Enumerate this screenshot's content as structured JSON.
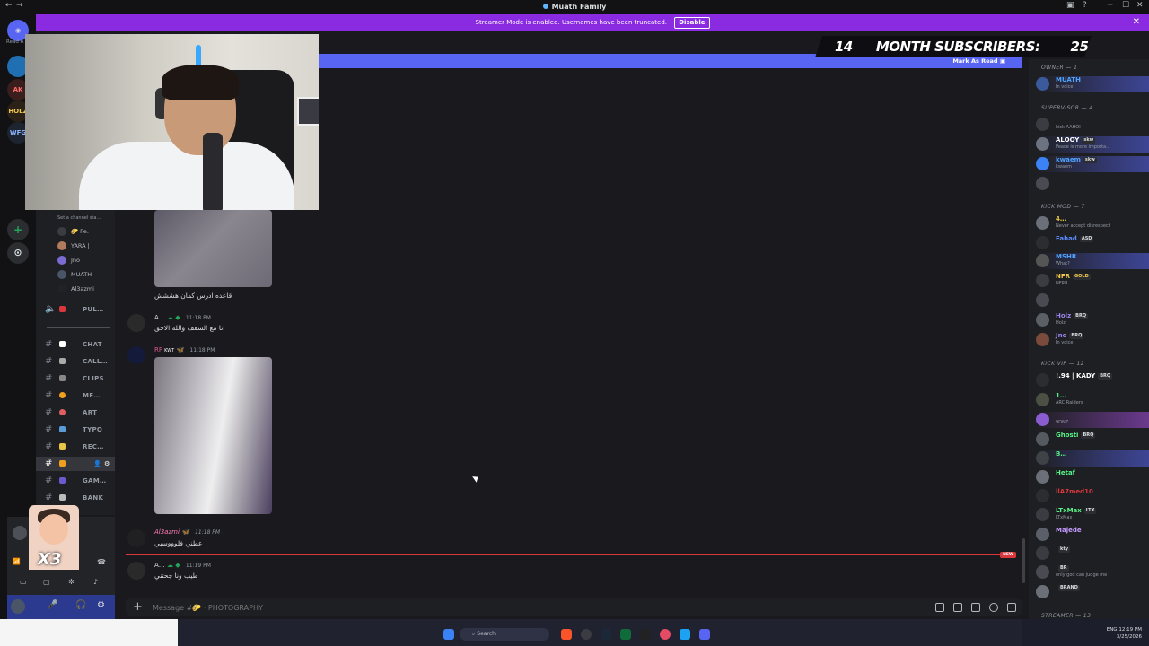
{
  "window": {
    "title": "Muath Family"
  },
  "streamer_bar": {
    "text": "Streamer Mode is enabled. Usernames have been truncated.",
    "disable_label": "Disable"
  },
  "overlay": {
    "count_left": "14",
    "label": "MONTH SUBSCRIBERS:",
    "count_right": "25"
  },
  "mark_read": {
    "label": "Mark As Read"
  },
  "rail": {
    "top_label": "Read A",
    "servers": [
      "AK",
      "HOLZ",
      "WFG",
      "+",
      "⊙"
    ]
  },
  "channels": {
    "status_hint": "Set a channel sta…",
    "voice_users": [
      "YARA |",
      "Jno",
      "MUATH",
      "Al3azmi"
    ],
    "list": [
      {
        "label": "PUL…",
        "voice": true
      },
      {
        "label": "CHAT"
      },
      {
        "label": "CALL…"
      },
      {
        "label": "CLIPS"
      },
      {
        "label": "ME…"
      },
      {
        "label": "ART"
      },
      {
        "label": "TYPO"
      },
      {
        "label": "REC…"
      },
      {
        "label": "",
        "active": true
      },
      {
        "label": "GAM…"
      },
      {
        "label": "BANK"
      }
    ],
    "baby_overlay_text": "X3"
  },
  "messages": [
    {
      "text": "قاعده ادرس كمان هششش"
    },
    {
      "name": "A…",
      "time": "11:18 PM",
      "text": "انا مع السقف والله الاحق"
    },
    {
      "name": "RF",
      "badge": "KWT",
      "time": "11:18 PM"
    },
    {
      "name": "Al3azmi",
      "time": "11:18 PM",
      "text": "عطني فلوووسيي"
    },
    {
      "name": "A…",
      "time": "11:19 PM",
      "text": "طيب ونا جحتني"
    }
  ],
  "new_badge": "NEW",
  "composer": {
    "placeholder": "Message #🌮 · PHOTOGRAPHY"
  },
  "members": {
    "groups": [
      {
        "label": "OWNER — 1"
      },
      {
        "label": "SUPERVISOR — 4"
      },
      {
        "label": "KICK MOD — 7"
      },
      {
        "label": "KICK VIP — 12"
      },
      {
        "label": "STREAMER — 13"
      }
    ],
    "owner": [
      {
        "name": "MUATH",
        "status": "In voice",
        "color": "#4fa3ff"
      }
    ],
    "supervisor": [
      {
        "name": "",
        "status": "kick AAHOI",
        "color": "#da373c"
      },
      {
        "name": "ALOOY",
        "tag": "skw",
        "status": "Peace is more importa…",
        "color": "#ffffff"
      },
      {
        "name": "kwaem",
        "tag": "skw",
        "status": "kwaem",
        "color": "#4fa3ff"
      },
      {
        "name": "",
        "status": "",
        "color": "#da373c"
      }
    ],
    "kick_mod": [
      {
        "name": "4…",
        "status": "Never accept disrespect",
        "color": "#e8c547"
      },
      {
        "name": "Fahad",
        "tag": "ASD",
        "status": "",
        "color": "#5b8cff"
      },
      {
        "name": "MSHR",
        "status": "What?",
        "color": "#4fa3ff"
      },
      {
        "name": "NFR",
        "tag": "GOLD",
        "status": "NFRR",
        "color": "#f0c94a"
      },
      {
        "name": "",
        "status": "",
        "color": "#da373c"
      },
      {
        "name": "Holz",
        "tag": "BRQ",
        "status": "Holz",
        "color": "#9b84ee"
      },
      {
        "name": "Jno",
        "tag": "BRQ",
        "status": "In voice",
        "color": "#9b84ee"
      }
    ],
    "kick_vip": [
      {
        "name": "!.94 | KADY",
        "tag": "BRQ",
        "status": "",
        "color": "#ffffff"
      },
      {
        "name": "1…",
        "status": "ARC Raiders",
        "color": "#57f287"
      },
      {
        "name": "",
        "status": "9DNZ",
        "color": "#da373c"
      },
      {
        "name": "Ghosti",
        "tag": "BRQ",
        "status": "",
        "color": "#57f287"
      },
      {
        "name": "B…",
        "status": "",
        "color": "#57f287"
      },
      {
        "name": "Hetaf",
        "status": "",
        "color": "#57f287"
      },
      {
        "name": "llA7med10",
        "status": "",
        "color": "#da373c"
      },
      {
        "name": "LTxMax",
        "tag": "LTX",
        "status": "LTxMax",
        "color": "#57f287"
      },
      {
        "name": "Majede",
        "status": "",
        "color": "#c39bff"
      },
      {
        "name": "",
        "tag": "kty",
        "status": "",
        "color": "#da373c"
      },
      {
        "name": "",
        "tag": "BR",
        "status": "only god can judge me",
        "color": "#da373c"
      },
      {
        "name": "",
        "tag": "BRAND",
        "status": "",
        "color": "#da373c"
      }
    ]
  },
  "taskbar": {
    "search": "Search",
    "lang": "ENG",
    "time": "12:19 PM",
    "date": "3/25/2026"
  }
}
